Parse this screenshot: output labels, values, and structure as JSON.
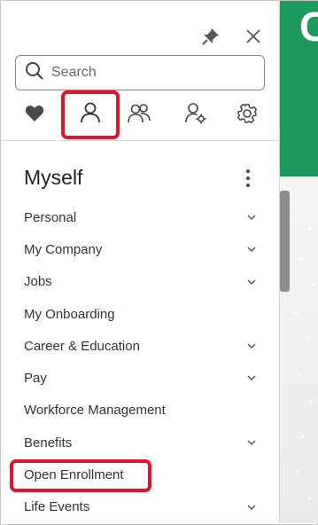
{
  "window": {
    "pin_icon": "pin-icon",
    "close_icon": "close-icon"
  },
  "search": {
    "placeholder": "Search",
    "value": "",
    "icon": "search-icon"
  },
  "categories": [
    {
      "name": "favorites",
      "icon": "heart-icon",
      "selected": false
    },
    {
      "name": "myself",
      "icon": "person-icon",
      "selected": true
    },
    {
      "name": "my-team",
      "icon": "team-icon",
      "selected": false
    },
    {
      "name": "user-settings",
      "icon": "person-gear-icon",
      "selected": false
    },
    {
      "name": "settings",
      "icon": "gear-icon",
      "selected": false
    }
  ],
  "section": {
    "title": "Myself",
    "more_icon": "kebab-icon"
  },
  "menu": [
    {
      "label": "Personal",
      "expandable": true
    },
    {
      "label": "My Company",
      "expandable": true
    },
    {
      "label": "Jobs",
      "expandable": true
    },
    {
      "label": "My Onboarding",
      "expandable": false
    },
    {
      "label": "Career & Education",
      "expandable": true
    },
    {
      "label": "Pay",
      "expandable": true
    },
    {
      "label": "Workforce Management",
      "expandable": false
    },
    {
      "label": "Benefits",
      "expandable": true
    },
    {
      "label": "Open Enrollment",
      "expandable": false,
      "highlighted": true
    },
    {
      "label": "Life Events",
      "expandable": true
    }
  ],
  "colors": {
    "highlight": "#e0142a",
    "brand": "#1c9a5e"
  }
}
